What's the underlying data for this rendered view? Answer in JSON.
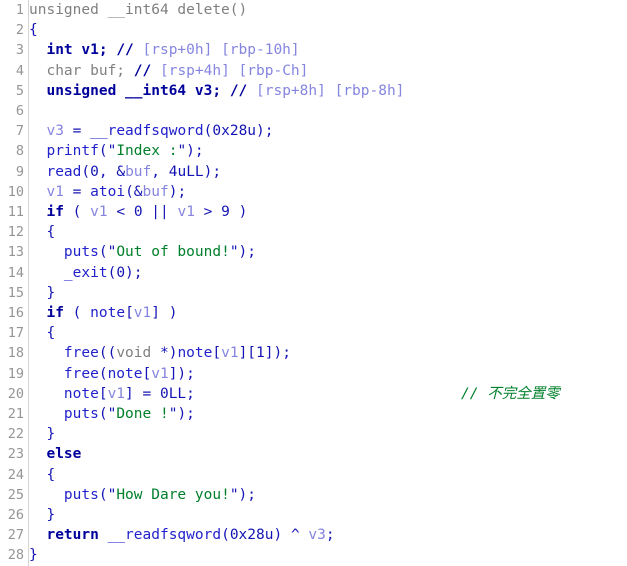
{
  "view": {
    "title": "Pseudocode-A",
    "total_lines": 28,
    "colors": {
      "background": "#ffffff",
      "gutter_text": "#959595",
      "gutter_separator": "#d4d4d4",
      "default_text": "#1414b4",
      "dimmed": "#808080",
      "keyword": "#00009b",
      "function": "#2222cc",
      "local_variable": "#8585e0",
      "string": "#00802b",
      "auto_comment": "#8585e0",
      "user_comment": "#00802b"
    }
  },
  "line_numbers": [
    "1",
    "2",
    "3",
    "4",
    "5",
    "6",
    "7",
    "8",
    "9",
    "10",
    "11",
    "12",
    "13",
    "14",
    "15",
    "16",
    "17",
    "18",
    "19",
    "20",
    "21",
    "22",
    "23",
    "24",
    "25",
    "26",
    "27",
    "28"
  ],
  "lines": [
    {
      "n": "1",
      "text": "unsigned __int64 delete()",
      "tokens": [
        {
          "c": "t-dim",
          "t": "unsigned __int64 delete()"
        }
      ]
    },
    {
      "n": "2",
      "text": "{",
      "tokens": [
        {
          "c": "t-punct",
          "t": "{"
        }
      ]
    },
    {
      "n": "3",
      "text": "  int v1; // [rsp+0h] [rbp-10h]",
      "tokens": [
        {
          "c": "t-plain",
          "t": "  "
        },
        {
          "c": "t-kw",
          "t": "int v1;"
        },
        {
          "c": "t-plain",
          "t": " "
        },
        {
          "c": "t-kw",
          "t": "//"
        },
        {
          "c": "t-cmt",
          "t": " [rsp+0h] [rbp-10h]"
        }
      ]
    },
    {
      "n": "4",
      "text": "  char buf; // [rsp+4h] [rbp-Ch]",
      "tokens": [
        {
          "c": "t-plain",
          "t": "  "
        },
        {
          "c": "t-dim",
          "t": "char buf;"
        },
        {
          "c": "t-plain",
          "t": " "
        },
        {
          "c": "t-kw",
          "t": "//"
        },
        {
          "c": "t-cmt",
          "t": " [rsp+4h] [rbp-Ch]"
        }
      ]
    },
    {
      "n": "5",
      "text": "  unsigned __int64 v3; // [rsp+8h] [rbp-8h]",
      "tokens": [
        {
          "c": "t-plain",
          "t": "  "
        },
        {
          "c": "t-kw",
          "t": "unsigned __int64 v3;"
        },
        {
          "c": "t-plain",
          "t": " "
        },
        {
          "c": "t-kw",
          "t": "//"
        },
        {
          "c": "t-cmt",
          "t": " [rsp+8h] [rbp-8h]"
        }
      ]
    },
    {
      "n": "6",
      "text": "",
      "tokens": []
    },
    {
      "n": "7",
      "text": "  v3 = __readfsqword(0x28u);",
      "tokens": [
        {
          "c": "t-plain",
          "t": "  "
        },
        {
          "c": "t-var",
          "t": "v3"
        },
        {
          "c": "t-punct",
          "t": " = "
        },
        {
          "c": "t-fn",
          "t": "__readfsqword"
        },
        {
          "c": "t-punct",
          "t": "("
        },
        {
          "c": "t-num",
          "t": "0x28u"
        },
        {
          "c": "t-punct",
          "t": ");"
        }
      ]
    },
    {
      "n": "8",
      "text": "  printf(\"Index :\");",
      "tokens": [
        {
          "c": "t-plain",
          "t": "  "
        },
        {
          "c": "t-fn",
          "t": "printf"
        },
        {
          "c": "t-punct",
          "t": "("
        },
        {
          "c": "t-quote",
          "t": "\""
        },
        {
          "c": "t-str",
          "t": "Index :"
        },
        {
          "c": "t-quote",
          "t": "\""
        },
        {
          "c": "t-punct",
          "t": ");"
        }
      ]
    },
    {
      "n": "9",
      "text": "  read(0, &buf, 4uLL);",
      "tokens": [
        {
          "c": "t-plain",
          "t": "  "
        },
        {
          "c": "t-fn",
          "t": "read"
        },
        {
          "c": "t-punct",
          "t": "("
        },
        {
          "c": "t-num",
          "t": "0"
        },
        {
          "c": "t-punct",
          "t": ", &"
        },
        {
          "c": "t-var",
          "t": "buf"
        },
        {
          "c": "t-punct",
          "t": ", "
        },
        {
          "c": "t-num",
          "t": "4uLL"
        },
        {
          "c": "t-punct",
          "t": ");"
        }
      ]
    },
    {
      "n": "10",
      "text": "  v1 = atoi(&buf);",
      "tokens": [
        {
          "c": "t-plain",
          "t": "  "
        },
        {
          "c": "t-var",
          "t": "v1"
        },
        {
          "c": "t-punct",
          "t": " = "
        },
        {
          "c": "t-fn",
          "t": "atoi"
        },
        {
          "c": "t-punct",
          "t": "(&"
        },
        {
          "c": "t-var",
          "t": "buf"
        },
        {
          "c": "t-punct",
          "t": ");"
        }
      ]
    },
    {
      "n": "11",
      "text": "  if ( v1 < 0 || v1 > 9 )",
      "tokens": [
        {
          "c": "t-plain",
          "t": "  "
        },
        {
          "c": "t-kw",
          "t": "if"
        },
        {
          "c": "t-punct",
          "t": " ( "
        },
        {
          "c": "t-var",
          "t": "v1"
        },
        {
          "c": "t-punct",
          "t": " < "
        },
        {
          "c": "t-num",
          "t": "0"
        },
        {
          "c": "t-punct",
          "t": " || "
        },
        {
          "c": "t-var",
          "t": "v1"
        },
        {
          "c": "t-punct",
          "t": " > "
        },
        {
          "c": "t-num",
          "t": "9"
        },
        {
          "c": "t-punct",
          "t": " )"
        }
      ]
    },
    {
      "n": "12",
      "text": "  {",
      "tokens": [
        {
          "c": "t-plain",
          "t": "  "
        },
        {
          "c": "t-punct",
          "t": "{"
        }
      ]
    },
    {
      "n": "13",
      "text": "    puts(\"Out of bound!\");",
      "tokens": [
        {
          "c": "t-plain",
          "t": "    "
        },
        {
          "c": "t-fn",
          "t": "puts"
        },
        {
          "c": "t-punct",
          "t": "("
        },
        {
          "c": "t-quote",
          "t": "\""
        },
        {
          "c": "t-str",
          "t": "Out of bound!"
        },
        {
          "c": "t-quote",
          "t": "\""
        },
        {
          "c": "t-punct",
          "t": ");"
        }
      ]
    },
    {
      "n": "14",
      "text": "    _exit(0);",
      "tokens": [
        {
          "c": "t-plain",
          "t": "    "
        },
        {
          "c": "t-fn",
          "t": "_exit"
        },
        {
          "c": "t-punct",
          "t": "("
        },
        {
          "c": "t-num",
          "t": "0"
        },
        {
          "c": "t-punct",
          "t": ");"
        }
      ]
    },
    {
      "n": "15",
      "text": "  }",
      "tokens": [
        {
          "c": "t-plain",
          "t": "  "
        },
        {
          "c": "t-punct",
          "t": "}"
        }
      ]
    },
    {
      "n": "16",
      "text": "  if ( note[v1] )",
      "tokens": [
        {
          "c": "t-plain",
          "t": "  "
        },
        {
          "c": "t-kw",
          "t": "if"
        },
        {
          "c": "t-punct",
          "t": " ( "
        },
        {
          "c": "t-fn",
          "t": "note"
        },
        {
          "c": "t-punct",
          "t": "["
        },
        {
          "c": "t-var",
          "t": "v1"
        },
        {
          "c": "t-punct",
          "t": "] )"
        }
      ]
    },
    {
      "n": "17",
      "text": "  {",
      "tokens": [
        {
          "c": "t-plain",
          "t": "  "
        },
        {
          "c": "t-punct",
          "t": "{"
        }
      ]
    },
    {
      "n": "18",
      "text": "    free((void *)note[v1][1]);",
      "tokens": [
        {
          "c": "t-plain",
          "t": "    "
        },
        {
          "c": "t-fn",
          "t": "free"
        },
        {
          "c": "t-punct",
          "t": "(("
        },
        {
          "c": "t-dim",
          "t": "void"
        },
        {
          "c": "t-punct",
          "t": " *)"
        },
        {
          "c": "t-fn",
          "t": "note"
        },
        {
          "c": "t-punct",
          "t": "["
        },
        {
          "c": "t-var",
          "t": "v1"
        },
        {
          "c": "t-punct",
          "t": "]["
        },
        {
          "c": "t-num",
          "t": "1"
        },
        {
          "c": "t-punct",
          "t": "]);"
        }
      ]
    },
    {
      "n": "19",
      "text": "    free(note[v1]);",
      "tokens": [
        {
          "c": "t-plain",
          "t": "    "
        },
        {
          "c": "t-fn",
          "t": "free"
        },
        {
          "c": "t-punct",
          "t": "("
        },
        {
          "c": "t-fn",
          "t": "note"
        },
        {
          "c": "t-punct",
          "t": "["
        },
        {
          "c": "t-var",
          "t": "v1"
        },
        {
          "c": "t-punct",
          "t": "]);"
        }
      ]
    },
    {
      "n": "20",
      "text": "    note[v1] = 0LL;",
      "tokens": [
        {
          "c": "t-plain",
          "t": "    "
        },
        {
          "c": "t-fn",
          "t": "note"
        },
        {
          "c": "t-punct",
          "t": "["
        },
        {
          "c": "t-var",
          "t": "v1"
        },
        {
          "c": "t-punct",
          "t": "] = "
        },
        {
          "c": "t-num",
          "t": "0LL"
        },
        {
          "c": "t-punct",
          "t": ";"
        }
      ],
      "side_comment": "// 不完全置零"
    },
    {
      "n": "21",
      "text": "    puts(\"Done !\");",
      "tokens": [
        {
          "c": "t-plain",
          "t": "    "
        },
        {
          "c": "t-fn",
          "t": "puts"
        },
        {
          "c": "t-punct",
          "t": "("
        },
        {
          "c": "t-quote",
          "t": "\""
        },
        {
          "c": "t-str",
          "t": "Done !"
        },
        {
          "c": "t-quote",
          "t": "\""
        },
        {
          "c": "t-punct",
          "t": ");"
        }
      ]
    },
    {
      "n": "22",
      "text": "  }",
      "tokens": [
        {
          "c": "t-plain",
          "t": "  "
        },
        {
          "c": "t-punct",
          "t": "}"
        }
      ]
    },
    {
      "n": "23",
      "text": "  else",
      "tokens": [
        {
          "c": "t-plain",
          "t": "  "
        },
        {
          "c": "t-kw",
          "t": "else"
        }
      ]
    },
    {
      "n": "24",
      "text": "  {",
      "tokens": [
        {
          "c": "t-plain",
          "t": "  "
        },
        {
          "c": "t-punct",
          "t": "{"
        }
      ]
    },
    {
      "n": "25",
      "text": "    puts(\"How Dare you!\");",
      "tokens": [
        {
          "c": "t-plain",
          "t": "    "
        },
        {
          "c": "t-fn",
          "t": "puts"
        },
        {
          "c": "t-punct",
          "t": "("
        },
        {
          "c": "t-quote",
          "t": "\""
        },
        {
          "c": "t-str",
          "t": "How Dare you!"
        },
        {
          "c": "t-quote",
          "t": "\""
        },
        {
          "c": "t-punct",
          "t": ");"
        }
      ]
    },
    {
      "n": "26",
      "text": "  }",
      "tokens": [
        {
          "c": "t-plain",
          "t": "  "
        },
        {
          "c": "t-punct",
          "t": "}"
        }
      ]
    },
    {
      "n": "27",
      "text": "  return __readfsqword(0x28u) ^ v3;",
      "tokens": [
        {
          "c": "t-plain",
          "t": "  "
        },
        {
          "c": "t-kw",
          "t": "return"
        },
        {
          "c": "t-punct",
          "t": " "
        },
        {
          "c": "t-fn",
          "t": "__readfsqword"
        },
        {
          "c": "t-punct",
          "t": "("
        },
        {
          "c": "t-num",
          "t": "0x28u"
        },
        {
          "c": "t-punct",
          "t": ") ^ "
        },
        {
          "c": "t-var",
          "t": "v3"
        },
        {
          "c": "t-punct",
          "t": ";"
        }
      ]
    },
    {
      "n": "28",
      "text": "}",
      "tokens": [
        {
          "c": "t-punct",
          "t": "}"
        }
      ]
    }
  ]
}
